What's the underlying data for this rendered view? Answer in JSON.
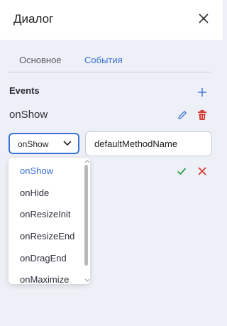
{
  "dialog": {
    "title": "Диалог"
  },
  "tabs": [
    {
      "label": "Основное"
    },
    {
      "label": "События"
    }
  ],
  "events": {
    "section_label": "Events",
    "current_event": "onShow",
    "select_value": "onShow",
    "method_value": "defaultMethodName"
  },
  "dropdown": {
    "options": [
      "onShow",
      "onHide",
      "onResizeInit",
      "onResizeEnd",
      "onDragEnd",
      "onMaximize"
    ],
    "selected": "onShow"
  },
  "colors": {
    "accent": "#3b73d6",
    "danger": "#d83a34",
    "success": "#2e9b4a"
  }
}
